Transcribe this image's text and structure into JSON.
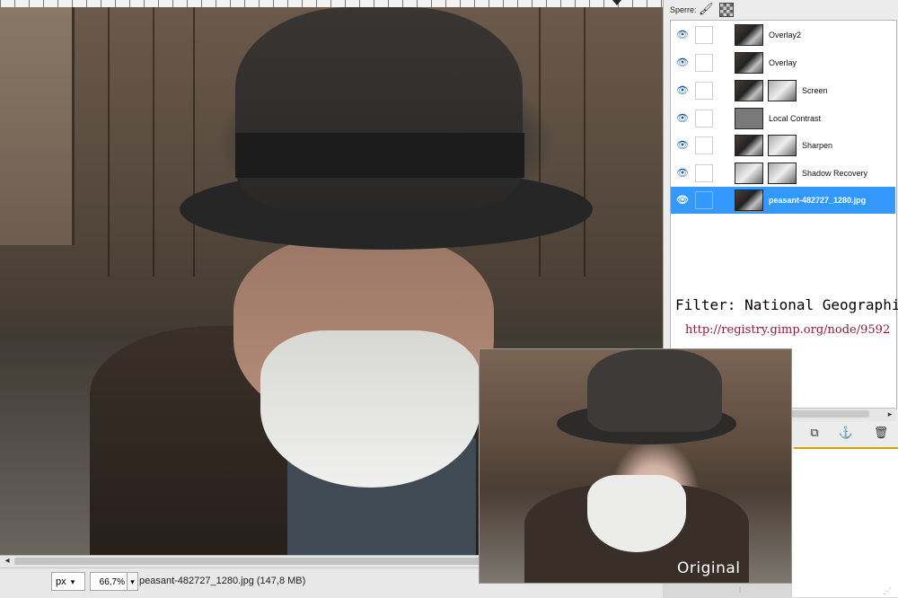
{
  "layers_dock": {
    "lock_label": "Sperre:",
    "lock_icons": [
      "brush-icon",
      "checkerboard-icon"
    ],
    "layers": [
      {
        "name": "Overlay2",
        "visible": true,
        "selected": false,
        "has_mask": false
      },
      {
        "name": "Overlay",
        "visible": true,
        "selected": false,
        "has_mask": false
      },
      {
        "name": "Screen",
        "visible": true,
        "selected": false,
        "has_mask": true
      },
      {
        "name": "Local Contrast",
        "visible": true,
        "selected": false,
        "has_mask": false
      },
      {
        "name": "Sharpen",
        "visible": true,
        "selected": false,
        "has_mask": true
      },
      {
        "name": "Shadow Recovery",
        "visible": true,
        "selected": false,
        "has_mask": true
      },
      {
        "name": "peasant-482727_1280.jpg",
        "visible": true,
        "selected": true,
        "has_mask": false
      }
    ],
    "bottom_buttons": [
      "merge-down-icon",
      "anchor-icon",
      "trash-icon"
    ]
  },
  "overlay_text": {
    "filter_label": "Filter: National Geographics",
    "filter_url": "http://registry.gimp.org/node/9592",
    "original_label": "Original"
  },
  "statusbar": {
    "unit": "px",
    "zoom": "66,7%",
    "image_info": "peasant-482727_1280.jpg (147,8 MB)"
  },
  "colors": {
    "selection": "#3399ff",
    "url_text": "#8b1d3b",
    "eye_icon": "#1b5e9e"
  }
}
